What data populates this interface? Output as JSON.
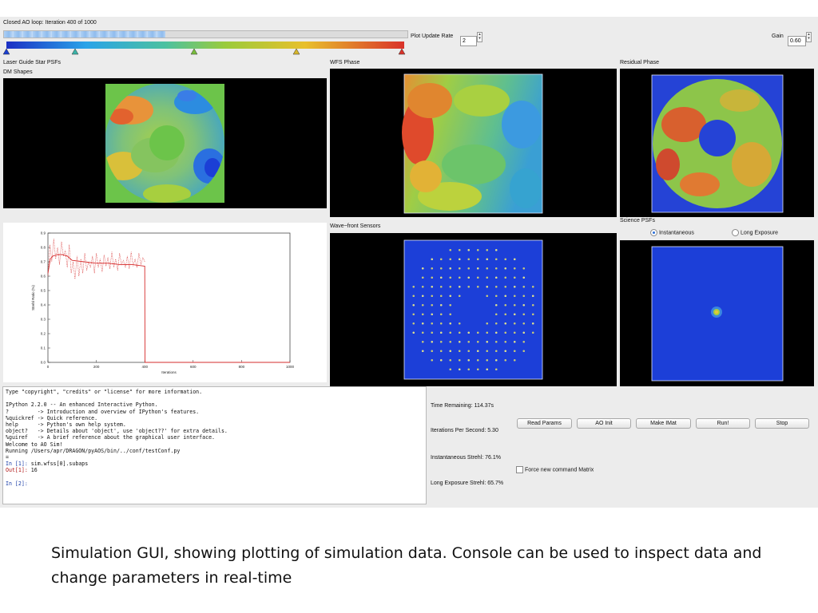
{
  "loop": {
    "status_label": "Closed AO loop: Iteration 400 of 1000",
    "progress_fraction": 0.4
  },
  "controls": {
    "plot_update_rate_label": "Plot Update Rate",
    "plot_update_rate_value": "2",
    "gain_label": "Gain",
    "gain_value": "0.60"
  },
  "panels": {
    "lgs_psfs": "Laser Guide Star PSFs",
    "dm_shapes": "DM Shapes",
    "wfs_phase": "WFS Phase",
    "residual_phase": "Residual Phase",
    "wavefront_sensors": "Wave−front Sensors",
    "science_psfs": "Science PSFs"
  },
  "science_psf_mode": {
    "instantaneous": "Instantaneous",
    "long_exposure": "Long Exposure",
    "selected": "instantaneous"
  },
  "stats": {
    "time_remaining": "Time Remaining: 114.37s",
    "iterations_per_second": "Iterations Per Second: 5.30",
    "instantaneous_strehl": "Instantaneous Strehl: 76.1%",
    "long_exposure_strehl": "Long Exposure Strehl: 65.7%"
  },
  "buttons": {
    "read_params": "Read Params",
    "ao_init": "AO Init",
    "make_imat": "Make IMat",
    "run": "Run!",
    "stop": "Stop"
  },
  "force_new_cmd_matrix": {
    "label": "Force new command Matrix",
    "checked": false
  },
  "console": {
    "lines": [
      "Type \"copyright\", \"credits\" or \"license\" for more information.",
      "",
      "IPython 2.2.0 -- An enhanced Interactive Python.",
      "?         -> Introduction and overview of IPython's features.",
      "%quickref -> Quick reference.",
      "help      -> Python's own help system.",
      "object?   -> Details about 'object', use 'object??' for extra details.",
      "%guiref   -> A brief reference about the graphical user interface.",
      "Welcome to AO Sim!",
      "Running /Users/apr/DRAGON/pyAOS/bin/../conf/testConf.py",
      "="
    ],
    "in1_prompt": "In [1]:",
    "in1_cmd": " sim.wfss[0].subaps",
    "out1_prompt": "Out[1]:",
    "out1_val": " 16",
    "in2_prompt": "In [2]:"
  },
  "chart_data": {
    "type": "line",
    "xlabel": "Iterations",
    "ylabel": "Strehl Ratio (%)",
    "xlim": [
      0,
      1000
    ],
    "ylim": [
      0,
      0.9
    ],
    "x_ticks": [
      "0",
      "200",
      "400",
      "600",
      "800",
      "1000"
    ],
    "y_ticks": [
      "0.0",
      "0.1",
      "0.2",
      "0.3",
      "0.4",
      "0.5",
      "0.6",
      "0.7",
      "0.8",
      "0.9"
    ],
    "series": [
      {
        "style": "solid",
        "color": "#d62b2b",
        "x": [
          0,
          10,
          20,
          40,
          60,
          80,
          100,
          150,
          200,
          250,
          300,
          350,
          399,
          400,
          401,
          1000
        ],
        "y": [
          0.62,
          0.72,
          0.74,
          0.75,
          0.75,
          0.74,
          0.71,
          0.7,
          0.69,
          0.69,
          0.68,
          0.68,
          0.67,
          0.67,
          0.0,
          0.0
        ]
      },
      {
        "style": "dotted",
        "color": "#d62b2b",
        "x": [
          0,
          8,
          16,
          24,
          32,
          40,
          48,
          56,
          64,
          72,
          80,
          88,
          96,
          104,
          112,
          120,
          128,
          136,
          144,
          152,
          160,
          168,
          176,
          184,
          192,
          200,
          208,
          216,
          224,
          232,
          240,
          248,
          256,
          264,
          272,
          280,
          288,
          296,
          304,
          312,
          320,
          328,
          336,
          344,
          352,
          360,
          368,
          376,
          384,
          392,
          400
        ],
        "y": [
          0.6,
          0.82,
          0.7,
          0.86,
          0.72,
          0.8,
          0.68,
          0.84,
          0.74,
          0.78,
          0.66,
          0.82,
          0.62,
          0.7,
          0.58,
          0.74,
          0.6,
          0.72,
          0.62,
          0.76,
          0.64,
          0.7,
          0.66,
          0.74,
          0.62,
          0.76,
          0.66,
          0.72,
          0.63,
          0.75,
          0.67,
          0.73,
          0.65,
          0.77,
          0.66,
          0.72,
          0.64,
          0.76,
          0.68,
          0.71,
          0.66,
          0.74,
          0.65,
          0.77,
          0.67,
          0.72,
          0.66,
          0.76,
          0.68,
          0.73,
          0.7
        ]
      }
    ]
  }
}
